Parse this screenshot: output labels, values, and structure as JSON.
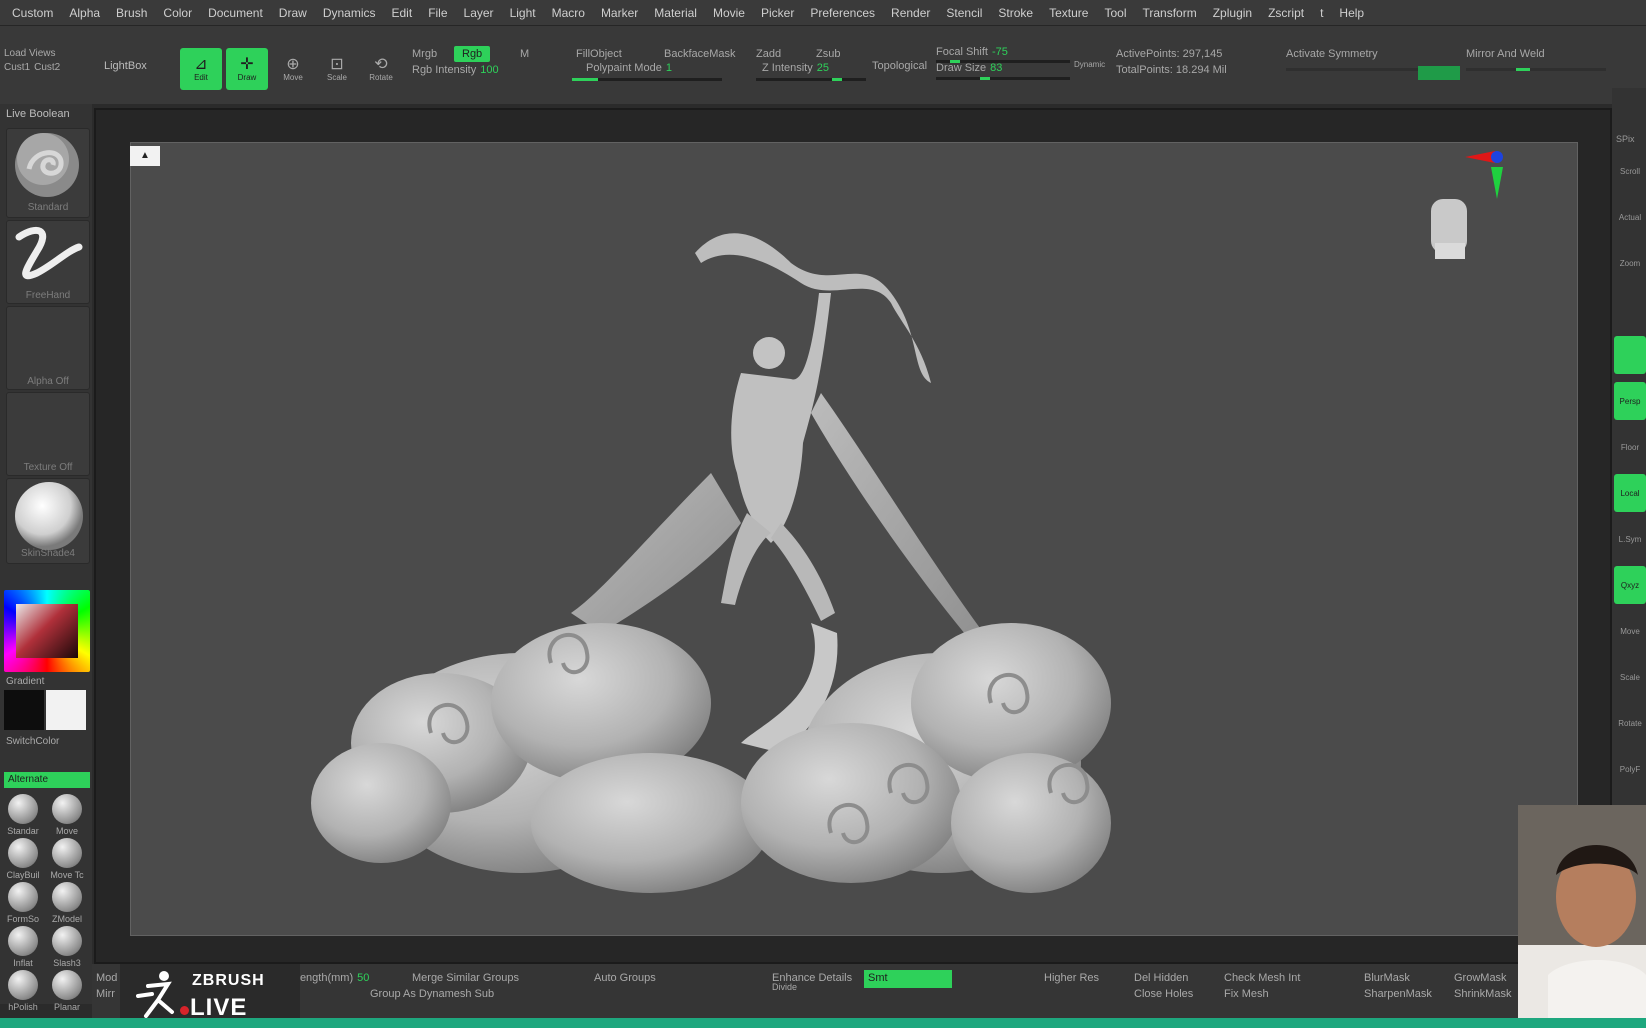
{
  "menu": [
    "Custom",
    "Alpha",
    "Brush",
    "Color",
    "Document",
    "Draw",
    "Dynamics",
    "Edit",
    "File",
    "Layer",
    "Light",
    "Macro",
    "Marker",
    "Material",
    "Movie",
    "Picker",
    "Preferences",
    "Render",
    "Stencil",
    "Stroke",
    "Texture",
    "Tool",
    "Transform",
    "Zplugin",
    "Zscript",
    "t",
    "Help"
  ],
  "shelf": {
    "load_views": "Load Views",
    "cust1": "Cust1",
    "cust2": "Cust2",
    "lightbox": "LightBox",
    "tools": [
      {
        "label": "Edit",
        "glyph": "⊿",
        "on": true
      },
      {
        "label": "Draw",
        "glyph": "✛",
        "on": true
      },
      {
        "label": "Move",
        "glyph": "⊕",
        "on": false
      },
      {
        "label": "Scale",
        "glyph": "⊡",
        "on": false
      },
      {
        "label": "Rotate",
        "glyph": "⟲",
        "on": false
      }
    ],
    "mrgb": "Mrgb",
    "rgb": "Rgb",
    "m": "M",
    "rgb_intensity_label": "Rgb Intensity",
    "rgb_intensity": "100",
    "fillobject": "FillObject",
    "polypaint_label": "Polypaint Mode",
    "polypaint_value": "1",
    "backfacemask": "BackfaceMask",
    "zadd": "Zadd",
    "zsub": "Zsub",
    "z_intensity_label": "Z Intensity",
    "z_intensity": "25",
    "topological": "Topological",
    "focal_shift_label": "Focal Shift",
    "focal_shift": "-75",
    "draw_size_label": "Draw Size",
    "draw_size": "83",
    "dynamic": "Dynamic",
    "active_points": "ActivePoints: 297,145",
    "total_points": "TotalPoints: 18.294 Mil",
    "activate_symmetry": "Activate Symmetry",
    "mirror_and_weld": "Mirror And Weld"
  },
  "left": {
    "live_boolean": "Live Boolean",
    "brush_label": "Standard",
    "stroke_label": "FreeHand",
    "alpha_label": "Alpha Off",
    "texture_label": "Texture Off",
    "material_label": "SkinShade4",
    "gradient_label": "Gradient",
    "switch_color_label": "SwitchColor",
    "alternate_label": "Alternate",
    "brushes": [
      "Standar",
      "Move",
      "ClayBuil",
      "Move Tc",
      "FormSo",
      "ZModel",
      "Inflat",
      "Slash3",
      "hPolish",
      "Planar"
    ]
  },
  "canvas": {
    "background": "#4b4b4b",
    "model_color": "#bfbfbf",
    "corner_button": "▲"
  },
  "right": {
    "buttons": [
      {
        "label": "Scroll",
        "on": false
      },
      {
        "label": "Actual",
        "on": false
      },
      {
        "label": "Zoom",
        "on": false
      },
      {
        "label": "",
        "on": false
      },
      {
        "label": "",
        "on": true
      },
      {
        "label": "Persp",
        "on": true
      },
      {
        "label": "Floor",
        "on": false
      },
      {
        "label": "Local",
        "on": true
      },
      {
        "label": "L.Sym",
        "on": false
      },
      {
        "label": "Qxyz",
        "on": true
      },
      {
        "label": "Move",
        "on": false
      },
      {
        "label": "Scale",
        "on": false
      },
      {
        "label": "Rotate",
        "on": false
      },
      {
        "label": "PolyF",
        "on": false
      }
    ],
    "spix": "SPix"
  },
  "bottom": {
    "mod": "Mod",
    "mir": "Mirr",
    "length_label": "l length(mm)",
    "length_value": "50",
    "merge_similar_groups": "Merge Similar Groups",
    "group_as_dynamesh_sub": "Group As Dynamesh Sub",
    "auto_groups": "Auto Groups",
    "enhance_details": "Enhance Details",
    "divide": "Divide",
    "smt": "Smt",
    "higher_res": "Higher Res",
    "del_hidden": "Del Hidden",
    "close_holes": "Close Holes",
    "check_mesh_int": "Check Mesh Int",
    "fix_mesh": "Fix Mesh",
    "blurmask": "BlurMask",
    "sharpenmask": "SharpenMask",
    "growmask": "GrowMask",
    "shrinkmask": "ShrinkMask"
  },
  "logo": {
    "top": "ZBRUSH",
    "bottom": "LIVE"
  },
  "colors": {
    "accent": "#2ed15a",
    "panel": "#333333",
    "canvas": "#4b4b4b",
    "stream_bar": "#1ea77e"
  }
}
